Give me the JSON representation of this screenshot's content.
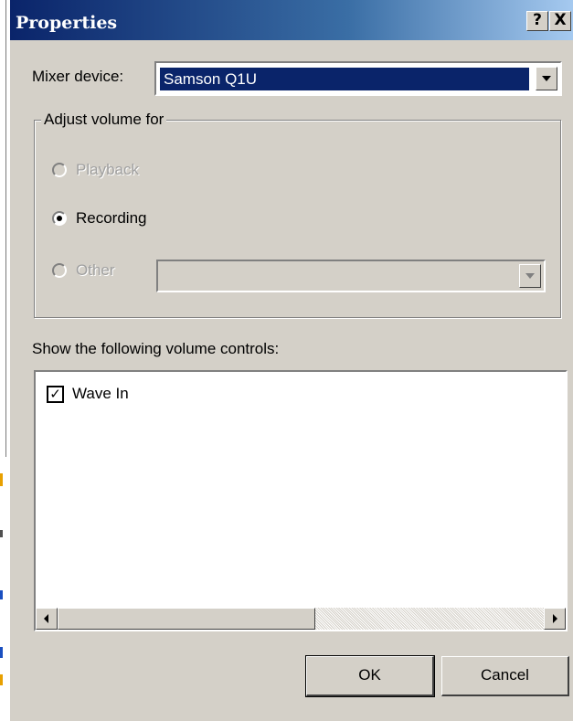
{
  "window": {
    "title": "Properties",
    "help_label": "?",
    "close_label": "X"
  },
  "mixer": {
    "label": "Mixer device:",
    "selected": "Samson Q1U"
  },
  "adjust_volume": {
    "title": "Adjust volume for",
    "options": [
      {
        "label": "Playback",
        "selected": false,
        "enabled": false
      },
      {
        "label": "Recording",
        "selected": true,
        "enabled": true
      },
      {
        "label": "Other",
        "selected": false,
        "enabled": false
      }
    ],
    "other_value": ""
  },
  "controls": {
    "label": "Show the following volume controls:",
    "items": [
      {
        "label": "Wave In",
        "checked": true,
        "check_glyph": "✓"
      }
    ]
  },
  "buttons": {
    "ok": "OK",
    "cancel": "Cancel"
  },
  "colors": {
    "dialog_bg": "#d4d0c8",
    "title_start": "#0a246a",
    "title_end": "#a6caf0",
    "selection": "#0a246a"
  }
}
